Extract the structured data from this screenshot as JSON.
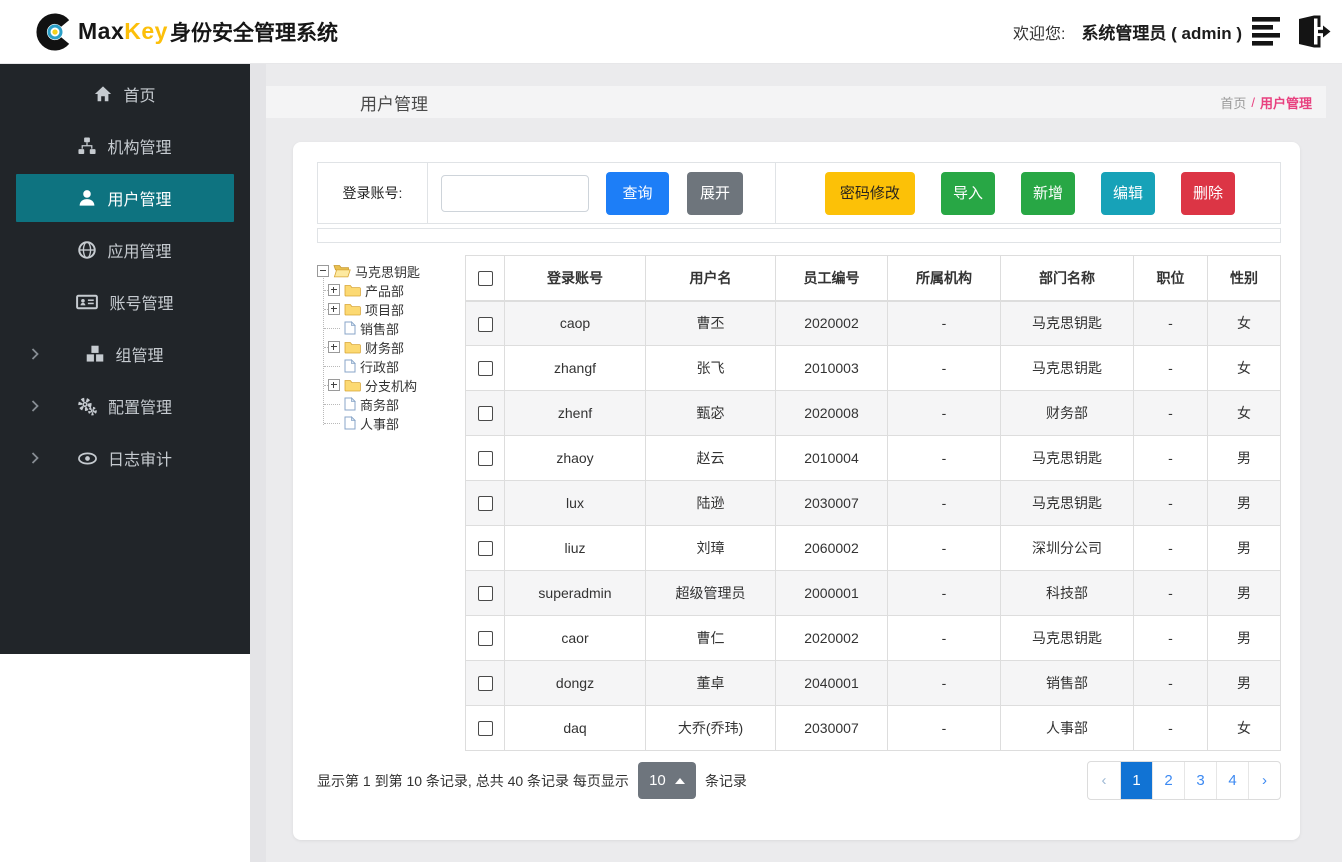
{
  "colors": {
    "sidebar_bg": "#212529",
    "sidebar_active": "#0e7380",
    "brand_key_yellow": "#fcbf0a",
    "breadcrumb_pink": "#e8407f",
    "primary_blue": "#1d7ef7",
    "secondary_gray": "#6e757c",
    "warning_yellow": "#fcc107",
    "success_green": "#28a745",
    "info_teal": "#17a2b8",
    "danger_red": "#dc3545",
    "pagination_active_blue": "#1173d4"
  },
  "topbar": {
    "brand_max": "Max",
    "brand_key": "Key",
    "brand_suffix": "身份安全管理系统",
    "welcome_label": "欢迎您:",
    "user_display": "系统管理员 ( admin )"
  },
  "sidebar": {
    "items": [
      {
        "label": "首页",
        "icon": "home-icon",
        "active": false,
        "has_chevron": false
      },
      {
        "label": "机构管理",
        "icon": "sitemap-icon",
        "active": false,
        "has_chevron": false
      },
      {
        "label": "用户管理",
        "icon": "user-icon",
        "active": true,
        "has_chevron": false
      },
      {
        "label": "应用管理",
        "icon": "globe-icon",
        "active": false,
        "has_chevron": false
      },
      {
        "label": "账号管理",
        "icon": "id-card-icon",
        "active": false,
        "has_chevron": false
      },
      {
        "label": "组管理",
        "icon": "cubes-icon",
        "active": false,
        "has_chevron": true
      },
      {
        "label": "配置管理",
        "icon": "gears-icon",
        "active": false,
        "has_chevron": true
      },
      {
        "label": "日志审计",
        "icon": "eye-icon",
        "active": false,
        "has_chevron": true
      }
    ]
  },
  "page": {
    "title": "用户管理",
    "breadcrumb_home": "首页",
    "breadcrumb_sep": "/",
    "breadcrumb_current": "用户管理"
  },
  "search": {
    "label": "登录账号:",
    "input_value": "",
    "query_button": "查询",
    "expand_button": "展开"
  },
  "actions": {
    "password": {
      "label": "密码修改",
      "color": "#fcc107"
    },
    "import": {
      "label": "导入",
      "color": "#28a745"
    },
    "add": {
      "label": "新增",
      "color": "#28a745"
    },
    "edit": {
      "label": "编辑",
      "color": "#17a2b8"
    },
    "delete": {
      "label": "删除",
      "color": "#dc3545"
    }
  },
  "tree": {
    "nodes": [
      {
        "label": "马克思钥匙",
        "icon": "folder-open",
        "toggle": "minus",
        "level": 0
      },
      {
        "label": "产品部",
        "icon": "folder-closed",
        "toggle": "plus",
        "level": 1
      },
      {
        "label": "项目部",
        "icon": "folder-closed",
        "toggle": "plus",
        "level": 1
      },
      {
        "label": "销售部",
        "icon": "file",
        "toggle": "none",
        "level": 1
      },
      {
        "label": "财务部",
        "icon": "folder-closed",
        "toggle": "plus",
        "level": 1
      },
      {
        "label": "行政部",
        "icon": "file",
        "toggle": "none",
        "level": 1
      },
      {
        "label": "分支机构",
        "icon": "folder-closed",
        "toggle": "plus",
        "level": 1
      },
      {
        "label": "商务部",
        "icon": "file",
        "toggle": "none",
        "level": 1
      },
      {
        "label": "人事部",
        "icon": "file",
        "toggle": "none",
        "level": 1
      }
    ]
  },
  "table": {
    "columns": [
      "登录账号",
      "用户名",
      "员工编号",
      "所属机构",
      "部门名称",
      "职位",
      "性别"
    ],
    "rows": [
      {
        "login": "caop",
        "name": "曹丕",
        "emp_no": "2020002",
        "org": "-",
        "dept": "马克思钥匙",
        "position": "-",
        "gender": "女"
      },
      {
        "login": "zhangf",
        "name": "张飞",
        "emp_no": "2010003",
        "org": "-",
        "dept": "马克思钥匙",
        "position": "-",
        "gender": "女"
      },
      {
        "login": "zhenf",
        "name": "甄宓",
        "emp_no": "2020008",
        "org": "-",
        "dept": "财务部",
        "position": "-",
        "gender": "女"
      },
      {
        "login": "zhaoy",
        "name": "赵云",
        "emp_no": "2010004",
        "org": "-",
        "dept": "马克思钥匙",
        "position": "-",
        "gender": "男"
      },
      {
        "login": "lux",
        "name": "陆逊",
        "emp_no": "2030007",
        "org": "-",
        "dept": "马克思钥匙",
        "position": "-",
        "gender": "男"
      },
      {
        "login": "liuz",
        "name": "刘璋",
        "emp_no": "2060002",
        "org": "-",
        "dept": "深圳分公司",
        "position": "-",
        "gender": "男"
      },
      {
        "login": "superadmin",
        "name": "超级管理员",
        "emp_no": "2000001",
        "org": "-",
        "dept": "科技部",
        "position": "-",
        "gender": "男"
      },
      {
        "login": "caor",
        "name": "曹仁",
        "emp_no": "2020002",
        "org": "-",
        "dept": "马克思钥匙",
        "position": "-",
        "gender": "男"
      },
      {
        "login": "dongz",
        "name": "董卓",
        "emp_no": "2040001",
        "org": "-",
        "dept": "销售部",
        "position": "-",
        "gender": "男"
      },
      {
        "login": "daq",
        "name": "大乔(乔玮)",
        "emp_no": "2030007",
        "org": "-",
        "dept": "人事部",
        "position": "-",
        "gender": "女"
      }
    ]
  },
  "pagination": {
    "info_prefix": "显示第 1 到第 10 条记录, 总共 40 条记录 每页显示",
    "page_size": "10",
    "info_suffix": "条记录",
    "prev_label": "‹",
    "pages": [
      "1",
      "2",
      "3",
      "4"
    ],
    "active_page": "1",
    "next_label": "›"
  }
}
